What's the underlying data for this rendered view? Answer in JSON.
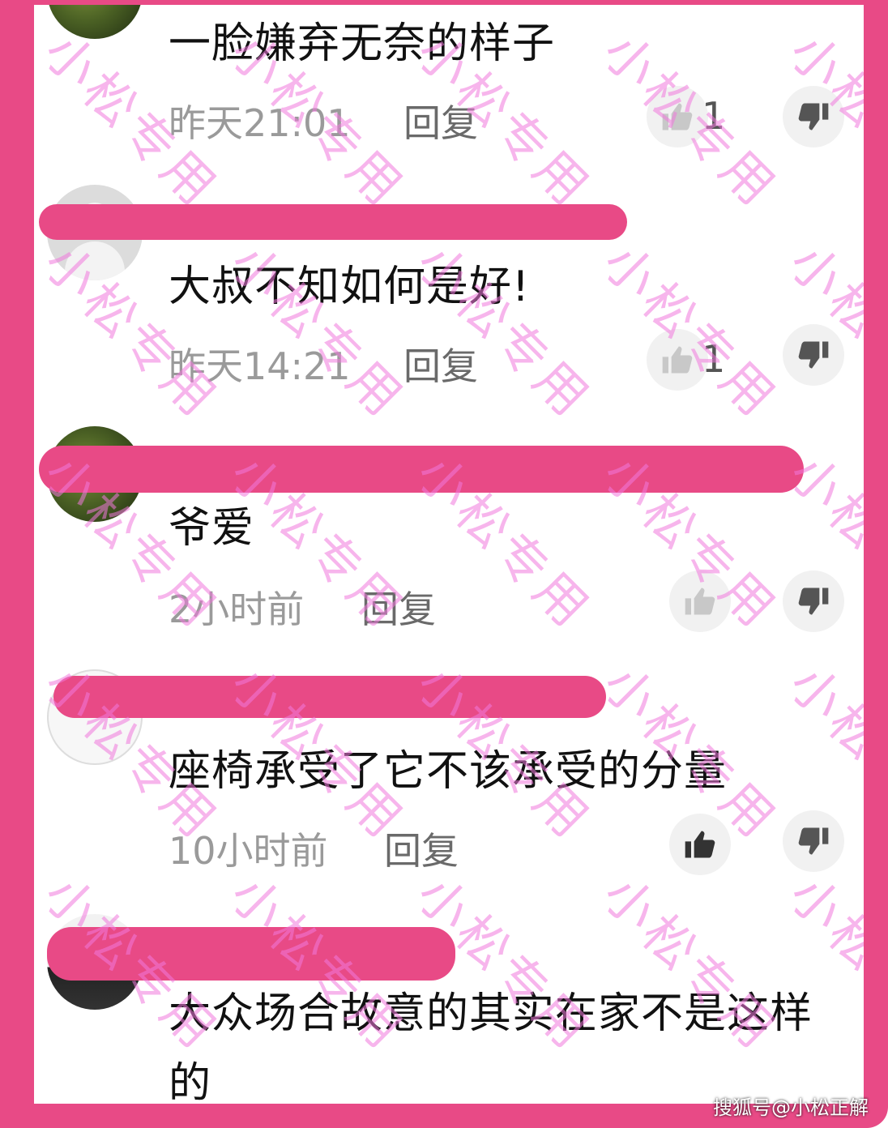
{
  "comments": [
    {
      "text": "一脸嫌弃无奈的样子",
      "time": "昨天21:01",
      "reply_label": "回复",
      "likes": "1"
    },
    {
      "text": "大叔不知如何是好!",
      "time": "昨天14:21",
      "reply_label": "回复",
      "likes": "1"
    },
    {
      "text": "爷爱",
      "time": "2小时前",
      "reply_label": "回复",
      "likes": ""
    },
    {
      "text": "座椅承受了它不该承受的分量",
      "time": "10小时前",
      "reply_label": "回复",
      "likes": ""
    },
    {
      "text": "大众场合故意的其实在家不是这样的",
      "time": "",
      "reply_label": "",
      "likes": ""
    }
  ],
  "watermark": "小松专用",
  "credit": "搜狐号@小松正解",
  "colors": {
    "frame": "#e84a86",
    "watermark": "#f078dc"
  },
  "icons": {
    "like": "thumbs-up-icon",
    "dislike": "thumbs-down-icon"
  }
}
